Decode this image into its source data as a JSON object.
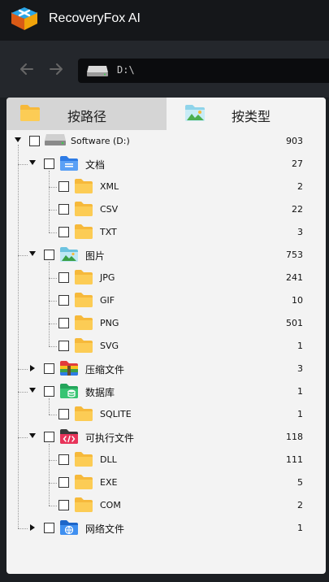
{
  "app": {
    "title": "RecoveryFox AI"
  },
  "address": {
    "path": "D:\\"
  },
  "tabs": [
    {
      "label": "按路径",
      "active": false
    },
    {
      "label": "按类型",
      "active": true
    }
  ],
  "tree": {
    "root": {
      "label": "Software (D:)",
      "count": "903"
    },
    "categories": [
      {
        "label": "文档",
        "count": "27",
        "icon": "document-folder-icon",
        "expanded": true,
        "children": [
          {
            "label": "XML",
            "count": "2"
          },
          {
            "label": "CSV",
            "count": "22"
          },
          {
            "label": "TXT",
            "count": "3"
          }
        ]
      },
      {
        "label": "图片",
        "count": "753",
        "icon": "image-folder-icon",
        "expanded": true,
        "children": [
          {
            "label": "JPG",
            "count": "241"
          },
          {
            "label": "GIF",
            "count": "10"
          },
          {
            "label": "PNG",
            "count": "501"
          },
          {
            "label": "SVG",
            "count": "1"
          }
        ]
      },
      {
        "label": "压缩文件",
        "count": "3",
        "icon": "archive-folder-icon",
        "expanded": false,
        "children": []
      },
      {
        "label": "数据库",
        "count": "1",
        "icon": "database-folder-icon",
        "expanded": true,
        "children": [
          {
            "label": "SQLITE",
            "count": "1"
          }
        ]
      },
      {
        "label": "可执行文件",
        "count": "118",
        "icon": "executable-folder-icon",
        "expanded": true,
        "children": [
          {
            "label": "DLL",
            "count": "111"
          },
          {
            "label": "EXE",
            "count": "5"
          },
          {
            "label": "COM",
            "count": "2"
          }
        ]
      },
      {
        "label": "网络文件",
        "count": "1",
        "icon": "network-folder-icon",
        "expanded": false,
        "children": []
      }
    ]
  },
  "colors": {
    "titlebar": "#15171a",
    "navbar": "#24272c",
    "panel": "#f3f3f3",
    "folder": "#f6b93b",
    "accent_blue": "#2d7be5"
  }
}
